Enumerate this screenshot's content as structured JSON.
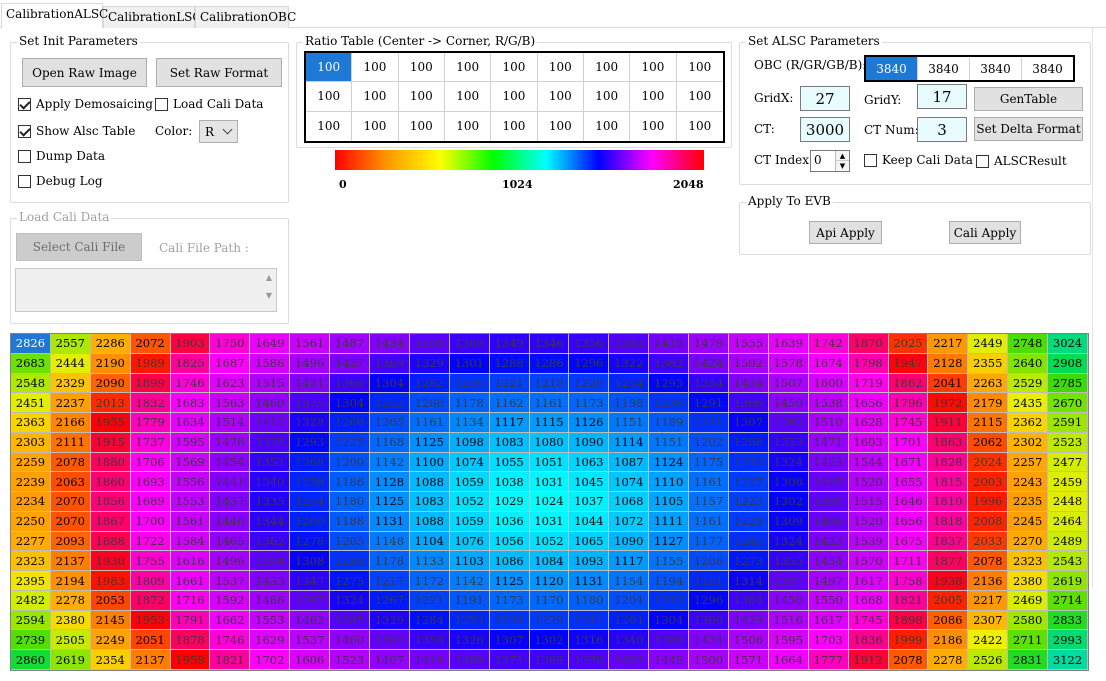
{
  "tabs": [
    "CalibrationALSC",
    "CalibrationLSC",
    "CalibrationOBC"
  ],
  "init": {
    "title": "Set Init Parameters",
    "open_raw": "Open Raw Image",
    "set_raw_format": "Set Raw Format",
    "apply_demosaicing": "Apply Demosaicing",
    "load_cali_data": "Load Cali Data",
    "show_alsc_table": "Show Alsc Table",
    "color_label": "Color:",
    "color_value": "R",
    "dump_data": "Dump Data",
    "debug_log": "Debug Log"
  },
  "load": {
    "title": "Load Cali Data",
    "select_file": "Select Cali File",
    "path_label": "Cali File Path :"
  },
  "ratio": {
    "title": "Ratio Table (Center -> Corner, R/G/B)",
    "rows": [
      [
        "100",
        "100",
        "100",
        "100",
        "100",
        "100",
        "100",
        "100",
        "100"
      ],
      [
        "100",
        "100",
        "100",
        "100",
        "100",
        "100",
        "100",
        "100",
        "100"
      ],
      [
        "100",
        "100",
        "100",
        "100",
        "100",
        "100",
        "100",
        "100",
        "100"
      ]
    ],
    "scale_min": "0",
    "scale_mid": "1024",
    "scale_max": "2048"
  },
  "alsc": {
    "title": "Set ALSC Parameters",
    "obc_label": "OBC (R/GR/GB/B):",
    "obc": [
      "3840",
      "3840",
      "3840",
      "3840"
    ],
    "gridx_label": "GridX:",
    "gridx": "27",
    "gridy_label": "GridY:",
    "gridy": "17",
    "gentable": "GenTable",
    "ct_label": "CT:",
    "ct": "3000",
    "ctnum_label": "CT Num:",
    "ctnum": "3",
    "set_delta": "Set Delta Format",
    "ctindex_label": "CT Index:",
    "ctindex": "0",
    "keep_cali": "Keep Cali Data",
    "alsc_result": "ALSCResult"
  },
  "evb": {
    "title": "Apply To EVB",
    "api_apply": "Api Apply",
    "cali_apply": "Cali Apply"
  },
  "grid": [
    [
      2826,
      2557,
      2286,
      2072,
      1903,
      1750,
      1649,
      1561,
      1487,
      1434,
      1390,
      1360,
      1349,
      1346,
      1356,
      1382,
      1419,
      1479,
      1555,
      1639,
      1742,
      1870,
      2025,
      2217,
      2449,
      2748,
      3024
    ],
    [
      2683,
      2444,
      2190,
      1989,
      1825,
      1687,
      1586,
      1496,
      1427,
      1369,
      1329,
      1301,
      1288,
      1286,
      1296,
      1322,
      1362,
      1424,
      1502,
      1578,
      1674,
      1798,
      1947,
      2128,
      2355,
      2640,
      2908
    ],
    [
      2548,
      2329,
      2090,
      1899,
      1746,
      1623,
      1515,
      1431,
      1360,
      1304,
      1262,
      1236,
      1221,
      1218,
      1229,
      1254,
      1295,
      1354,
      1434,
      1507,
      1600,
      1719,
      1862,
      2041,
      2263,
      2529,
      2785
    ],
    [
      2451,
      2237,
      2013,
      1832,
      1683,
      1563,
      1460,
      1375,
      1304,
      1252,
      1208,
      1178,
      1162,
      1161,
      1173,
      1198,
      1236,
      1291,
      1366,
      1450,
      1538,
      1656,
      1796,
      1972,
      2179,
      2435,
      2670
    ],
    [
      2363,
      2166,
      1955,
      1779,
      1634,
      1514,
      1412,
      1328,
      1260,
      1205,
      1161,
      1134,
      1117,
      1115,
      1126,
      1151,
      1189,
      1241,
      1307,
      1393,
      1510,
      1628,
      1745,
      1911,
      2115,
      2362,
      2591
    ],
    [
      2303,
      2111,
      1915,
      1737,
      1595,
      1476,
      1378,
      1293,
      1225,
      1168,
      1125,
      1098,
      1083,
      1080,
      1090,
      1114,
      1151,
      1202,
      1268,
      1353,
      1471,
      1603,
      1701,
      1863,
      2062,
      2302,
      2523
    ],
    [
      2259,
      2078,
      1880,
      1706,
      1569,
      1454,
      1352,
      1268,
      1200,
      1142,
      1100,
      1074,
      1055,
      1051,
      1063,
      1087,
      1124,
      1175,
      1243,
      1324,
      1423,
      1544,
      1671,
      1828,
      2024,
      2257,
      2477
    ],
    [
      2239,
      2063,
      1860,
      1693,
      1556,
      1441,
      1340,
      1256,
      1186,
      1128,
      1088,
      1059,
      1038,
      1031,
      1045,
      1074,
      1110,
      1161,
      1227,
      1308,
      1405,
      1520,
      1655,
      1815,
      2003,
      2243,
      2459
    ],
    [
      2234,
      2070,
      1856,
      1689,
      1553,
      1437,
      1335,
      1254,
      1180,
      1125,
      1083,
      1052,
      1029,
      1024,
      1037,
      1068,
      1105,
      1157,
      1223,
      1302,
      1399,
      1515,
      1646,
      1810,
      1996,
      2235,
      2448
    ],
    [
      2250,
      2070,
      1867,
      1700,
      1561,
      1446,
      1344,
      1260,
      1188,
      1131,
      1088,
      1059,
      1036,
      1031,
      1044,
      1072,
      1111,
      1161,
      1229,
      1309,
      1406,
      1520,
      1656,
      1818,
      2008,
      2245,
      2464
    ],
    [
      2277,
      2093,
      1888,
      1722,
      1584,
      1465,
      1362,
      1278,
      1205,
      1148,
      1104,
      1076,
      1056,
      1052,
      1065,
      1090,
      1127,
      1177,
      1243,
      1324,
      1423,
      1539,
      1675,
      1837,
      2033,
      2270,
      2489
    ],
    [
      2323,
      2137,
      1930,
      1755,
      1616,
      1496,
      1394,
      1308,
      1238,
      1178,
      1133,
      1103,
      1086,
      1084,
      1093,
      1117,
      1155,
      1206,
      1273,
      1355,
      1454,
      1570,
      1711,
      1877,
      2078,
      2323,
      2543
    ],
    [
      2395,
      2194,
      1983,
      1809,
      1661,
      1537,
      1433,
      1347,
      1275,
      1217,
      1172,
      1142,
      1125,
      1120,
      1131,
      1154,
      1194,
      1251,
      1314,
      1397,
      1497,
      1617,
      1758,
      1938,
      2136,
      2380,
      2619
    ],
    [
      2482,
      2278,
      2053,
      1872,
      1716,
      1592,
      1486,
      1397,
      1324,
      1267,
      1221,
      1191,
      1173,
      1170,
      1180,
      1204,
      1243,
      1296,
      1364,
      1450,
      1550,
      1668,
      1821,
      2005,
      2217,
      2469,
      2714
    ],
    [
      2594,
      2380,
      2145,
      1953,
      1791,
      1662,
      1553,
      1462,
      1385,
      1329,
      1284,
      1253,
      1234,
      1229,
      1241,
      1264,
      1304,
      1360,
      1429,
      1516,
      1617,
      1745,
      1898,
      2086,
      2307,
      2580,
      2833
    ],
    [
      2739,
      2505,
      2249,
      2051,
      1878,
      1746,
      1629,
      1537,
      1460,
      1402,
      1356,
      1326,
      1307,
      1302,
      1316,
      1340,
      1380,
      1434,
      1506,
      1595,
      1703,
      1836,
      1999,
      2186,
      2422,
      2711,
      2993
    ],
    [
      2860,
      2619,
      2354,
      2137,
      1959,
      1821,
      1702,
      1606,
      1523,
      1467,
      1419,
      1389,
      1371,
      1365,
      1378,
      1403,
      1445,
      1500,
      1571,
      1664,
      1777,
      1912,
      2078,
      2278,
      2526,
      2831,
      3122
    ]
  ],
  "colors": {
    "select_blue": "#1e78d6",
    "value_bg": "#e8fbff"
  }
}
